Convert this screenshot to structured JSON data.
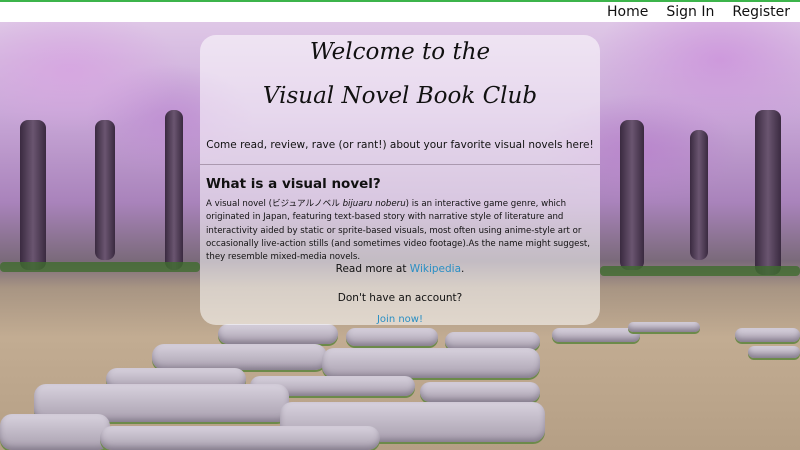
{
  "nav": {
    "home": "Home",
    "signin": "Sign In",
    "register": "Register"
  },
  "hero": {
    "title_line1": "Welcome to the",
    "title_line2": "Visual Novel Book Club",
    "tagline": "Come read, review, rave (or rant!) about your favorite visual novels here!"
  },
  "about": {
    "heading": "What is a visual novel?",
    "desc_prefix": "A visual novel (ビジュアルノベル ",
    "desc_romaji": "bijuaru noberu",
    "desc_body": ") is an interactive game genre, which originated in Japan, featuring text-based story with narrative style of literature and interactivity aided by static or sprite-based visuals, most often using anime-style art or occasionally live-action stills (and sometimes video footage).As the name might suggest, they resemble mixed-media novels.",
    "readmore_prefix": "Read more at ",
    "readmore_link": "Wikipedia",
    "readmore_suffix": "."
  },
  "signup": {
    "question": "Don't have an account?",
    "join": "Join now!"
  },
  "colors": {
    "link": "#2a8fc4",
    "topbar_accent": "#3cb44b"
  }
}
